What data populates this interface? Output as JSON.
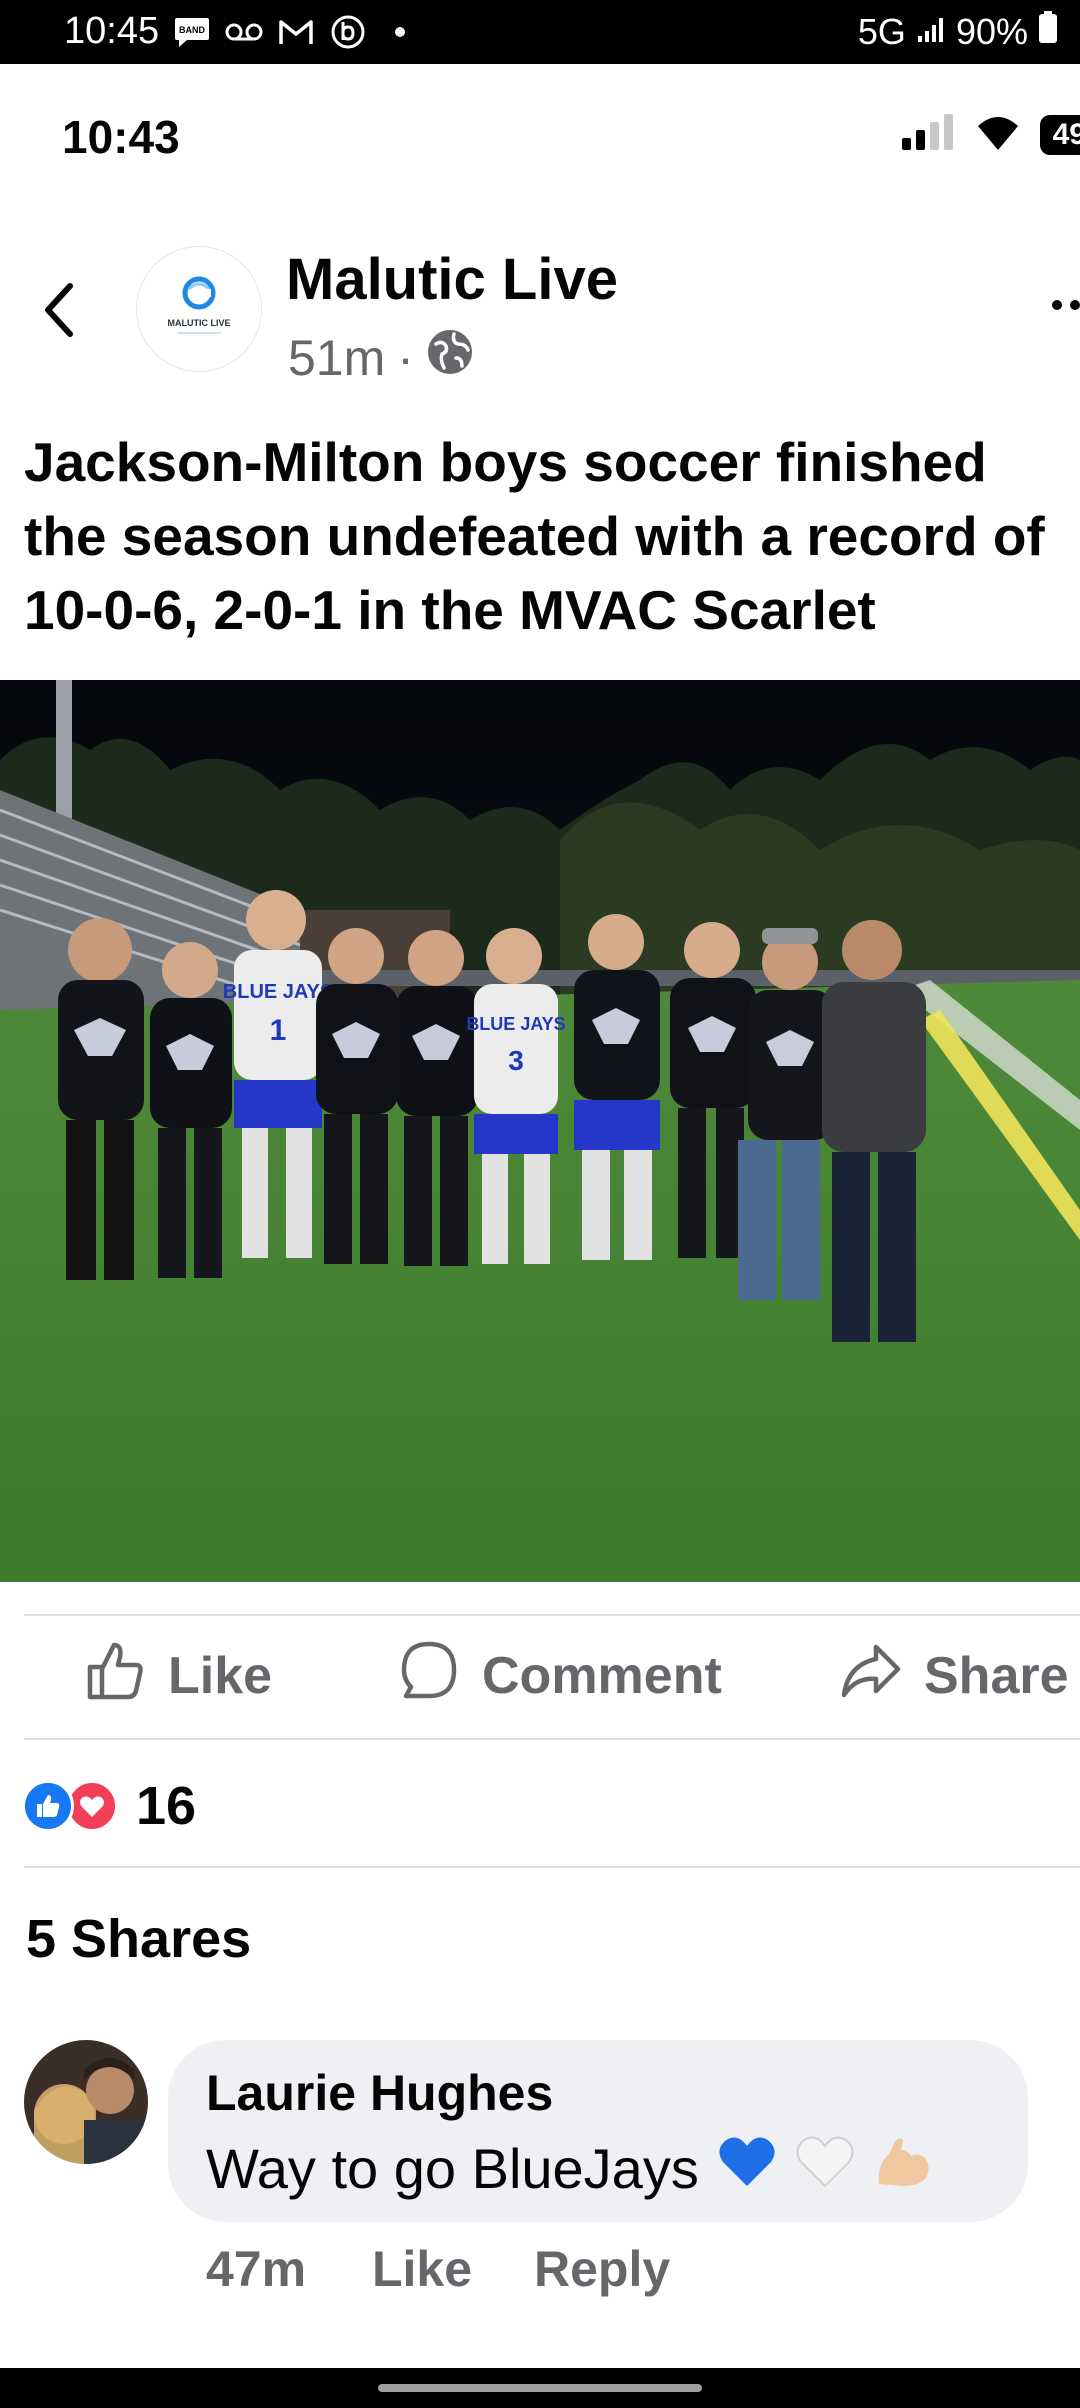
{
  "status_bar": {
    "time": "10:45",
    "band_badge": "BAND",
    "notification_icons": [
      "band-icon",
      "voicemail-icon",
      "gmail-icon",
      "b-app-icon",
      "dot-icon"
    ],
    "network": "5G",
    "battery": "90%"
  },
  "inner_status": {
    "time": "10:43",
    "battery": "49"
  },
  "post": {
    "page_logo_text": "MALUTIC LIVE",
    "author": "Malutic Live",
    "time_ago": "51m",
    "separator": "·",
    "text": "Jackson-Milton boys soccer finished the season undefeated with a record of 10-0-6, 2-0-1 in the MVAC Scarlet"
  },
  "photo": {
    "jersey_texts": [
      "BLUE JAYS",
      "1",
      "BLUE JAYS",
      "3"
    ]
  },
  "actions": {
    "like": "Like",
    "comment": "Comment",
    "share": "Share"
  },
  "reactions": {
    "count": "16",
    "types": [
      "like",
      "love"
    ]
  },
  "shares": "5 Shares",
  "comment": {
    "name": "Laurie Hughes",
    "text": "Way to go BlueJays",
    "emojis": [
      "blue-heart",
      "white-heart",
      "flexed-biceps"
    ],
    "time_ago": "47m",
    "like": "Like",
    "reply": "Reply"
  },
  "colors": {
    "facebook_blue": "#1877f2",
    "love_red": "#f33e58",
    "secondary_text": "#65676b"
  }
}
